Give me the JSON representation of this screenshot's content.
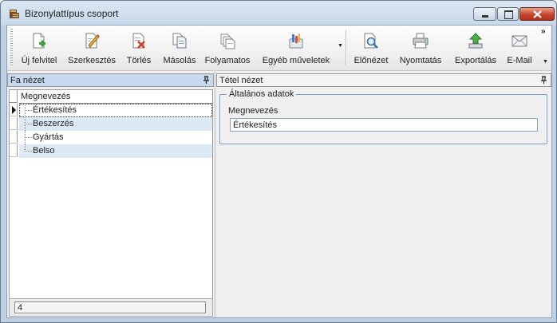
{
  "window": {
    "title": "Bizonylattípus csoport",
    "controls": {
      "minimize": "minimize",
      "maximize": "maximize",
      "close": "close"
    }
  },
  "toolbar": {
    "new_label": "Új felvitel",
    "edit_label": "Szerkesztés",
    "delete_label": "Törlés",
    "copy_label": "Másolás",
    "process_label": "Folyamatos",
    "other_label": "Egyéb műveletek",
    "preview_label": "Előnézet",
    "print_label": "Nyomtatás",
    "export_label": "Exportálás",
    "email_label": "E-Mail",
    "overflow_label": "»"
  },
  "tree_panel": {
    "title": "Fa nézet",
    "column_header": "Megnevezés",
    "items": [
      {
        "label": "Értékesítés",
        "selected": true
      },
      {
        "label": "Beszerzés"
      },
      {
        "label": "Gyártás"
      },
      {
        "label": "Belso"
      }
    ],
    "footer_count": "4"
  },
  "detail_panel": {
    "title": "Tétel nézet",
    "group_title": "Általános adatok",
    "name_label": "Megnevezés",
    "name_value": "Értékesítés"
  },
  "colors": {
    "panel_header_active": "#c7d9ee",
    "alt_row": "#dde9f5",
    "group_border": "#7aa1c9"
  }
}
